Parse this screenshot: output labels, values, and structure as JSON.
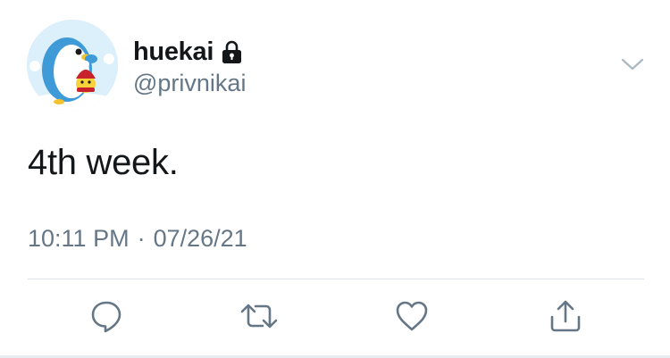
{
  "tweet": {
    "author": {
      "display_name": "huekai",
      "handle": "@privnikai",
      "avatar_icon": "penguin-avatar",
      "protected_icon": "lock-icon"
    },
    "text": "4th week.",
    "time": "10:11 PM",
    "separator": "·",
    "date": "07/26/21"
  },
  "actions": {
    "reply_icon": "reply-icon",
    "retweet_icon": "retweet-icon",
    "like_icon": "heart-icon",
    "share_icon": "share-icon",
    "more_icon": "chevron-down-icon"
  },
  "colors": {
    "text": "#14171a",
    "secondary": "#657786",
    "divider": "#dde3e8",
    "action_icon": "#657786"
  }
}
